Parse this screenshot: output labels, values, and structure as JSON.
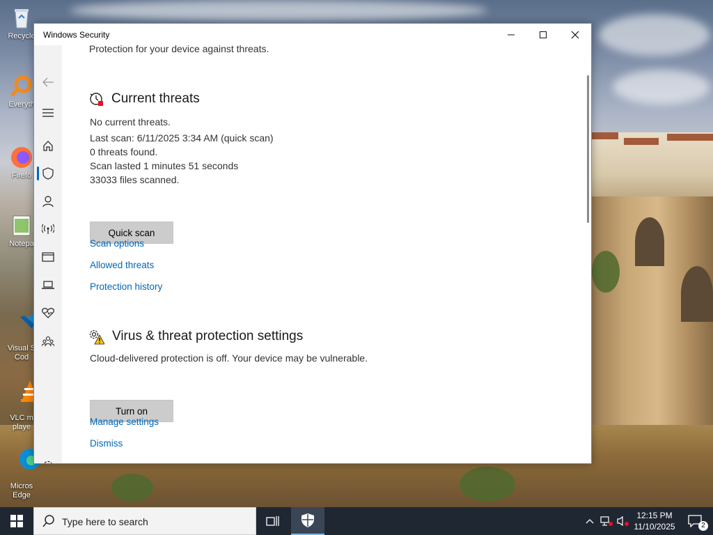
{
  "window": {
    "title": "Windows Security",
    "minimize_icon": "minimize-icon",
    "maximize_icon": "maximize-icon",
    "close_icon": "close-icon"
  },
  "nav": {
    "items": [
      {
        "name": "back",
        "icon": "back-arrow-icon"
      },
      {
        "name": "menu",
        "icon": "hamburger-icon"
      },
      {
        "name": "home",
        "icon": "home-icon"
      },
      {
        "name": "virus-protection",
        "icon": "shield-icon",
        "selected": true
      },
      {
        "name": "account-protection",
        "icon": "person-icon"
      },
      {
        "name": "firewall",
        "icon": "antenna-icon"
      },
      {
        "name": "app-browser-control",
        "icon": "browser-window-icon"
      },
      {
        "name": "device-security",
        "icon": "laptop-icon"
      },
      {
        "name": "device-performance",
        "icon": "heart-pulse-icon"
      },
      {
        "name": "family-options",
        "icon": "family-icon"
      },
      {
        "name": "settings",
        "icon": "gear-icon"
      }
    ]
  },
  "main": {
    "intro_text": "Protection for your device against threats.",
    "current_threats": {
      "heading": "Current threats",
      "icon": "clock-threat-icon",
      "status": "No current threats.",
      "last_scan": "Last scan: 6/11/2025 3:34 AM (quick scan)",
      "threats_found": "0 threats found.",
      "scan_duration": "Scan lasted 1 minutes 51 seconds",
      "files_scanned": "33033 files scanned.",
      "quick_scan_button": "Quick scan",
      "links": {
        "scan_options": "Scan options",
        "allowed_threats": "Allowed threats",
        "protection_history": "Protection history"
      }
    },
    "settings": {
      "heading": "Virus & threat protection settings",
      "icon": "gear-warning-icon",
      "message": "Cloud-delivered protection is off. Your device may be vulnerable.",
      "turn_on_button": "Turn on",
      "links": {
        "manage_settings": "Manage settings",
        "dismiss": "Dismiss"
      }
    }
  },
  "desktop": {
    "icons": [
      {
        "label": "Recycle",
        "icon": "recycle-bin-icon"
      },
      {
        "label": "Everyth",
        "icon": "everything-search-icon"
      },
      {
        "label": "Firefo",
        "icon": "firefox-icon"
      },
      {
        "label": "Notepa",
        "icon": "notepad-icon"
      },
      {
        "label": "Visual S\nCod",
        "icon": "vscode-icon"
      },
      {
        "label": "VLC m\nplaye",
        "icon": "vlc-icon"
      },
      {
        "label": "Micros\nEdge",
        "icon": "edge-icon"
      }
    ]
  },
  "taskbar": {
    "search_placeholder": "Type here to search",
    "time": "12:15 PM",
    "date": "11/10/2025",
    "notification_count": "2",
    "accent": "#1f2733"
  },
  "colors": {
    "link": "#0067b8",
    "button_bg": "#cccccc",
    "nav_bg": "#f2f2f2",
    "accent": "#0067c0"
  }
}
